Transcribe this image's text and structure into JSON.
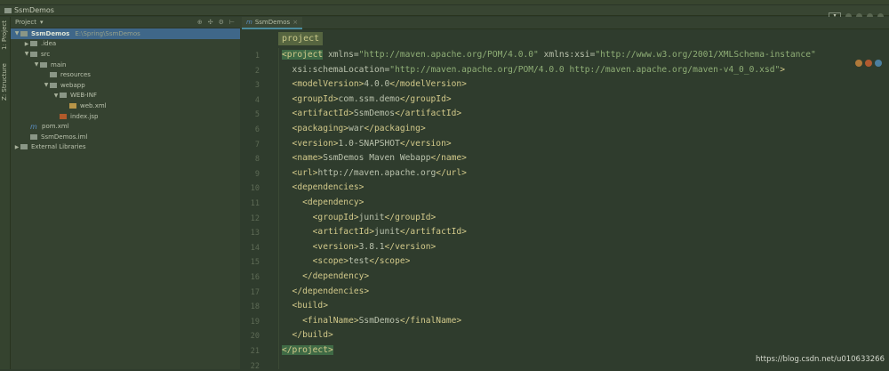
{
  "nav": {
    "project_name": "SsmDemos"
  },
  "side_strip": {
    "project_tab": "1: Project",
    "structure_tab": "Z: Structure"
  },
  "project_panel": {
    "view_label": "Project",
    "tree": [
      {
        "label": "SsmDemos",
        "path": "E:\\Spring\\SsmDemos",
        "depth": 0,
        "arrow": "▼",
        "icon": "folder",
        "selected": true
      },
      {
        "label": ".idea",
        "depth": 1,
        "arrow": "▶",
        "icon": "folder"
      },
      {
        "label": "src",
        "depth": 1,
        "arrow": "▼",
        "icon": "folder"
      },
      {
        "label": "main",
        "depth": 2,
        "arrow": "▼",
        "icon": "folder"
      },
      {
        "label": "resources",
        "depth": 3,
        "arrow": "",
        "icon": "folder"
      },
      {
        "label": "webapp",
        "depth": 3,
        "arrow": "▼",
        "icon": "folder"
      },
      {
        "label": "WEB-INF",
        "depth": 4,
        "arrow": "▼",
        "icon": "folder"
      },
      {
        "label": "web.xml",
        "depth": 5,
        "arrow": "",
        "icon": "xml"
      },
      {
        "label": "index.jsp",
        "depth": 4,
        "arrow": "",
        "icon": "jsp"
      },
      {
        "label": "pom.xml",
        "depth": 1,
        "arrow": "",
        "icon": "maven"
      },
      {
        "label": "SsmDemos.iml",
        "depth": 1,
        "arrow": "",
        "icon": "file"
      },
      {
        "label": "External Libraries",
        "depth": 0,
        "arrow": "▶",
        "icon": "library"
      }
    ]
  },
  "editor": {
    "tab_label": "SsmDemos",
    "breadcrumb": "project",
    "lines": [
      [
        [
          "hl",
          "<project"
        ],
        [
          "a",
          " xmlns="
        ],
        [
          "s",
          "\"http://maven.apache.org/POM/4.0.0\""
        ],
        [
          "a",
          " xmlns:xsi="
        ],
        [
          "s",
          "\"http://www.w3.org/2001/XMLSchema-instance\""
        ]
      ],
      [
        [
          "a",
          "  xsi:schemaLocation="
        ],
        [
          "s",
          "\"http://maven.apache.org/POM/4.0.0 http://maven.apache.org/maven-v4_0_0.xsd\""
        ],
        [
          "t",
          ">"
        ]
      ],
      [
        [
          "t",
          "  <modelVersion>"
        ],
        [
          "v",
          "4.0.0"
        ],
        [
          "t",
          "</modelVersion>"
        ]
      ],
      [
        [
          "t",
          "  <groupId>"
        ],
        [
          "v",
          "com.ssm.demo"
        ],
        [
          "t",
          "</groupId>"
        ]
      ],
      [
        [
          "t",
          "  <artifactId>"
        ],
        [
          "v",
          "SsmDemos"
        ],
        [
          "t",
          "</artifactId>"
        ]
      ],
      [
        [
          "t",
          "  <packaging>"
        ],
        [
          "v",
          "war"
        ],
        [
          "t",
          "</packaging>"
        ]
      ],
      [
        [
          "t",
          "  <version>"
        ],
        [
          "v",
          "1.0-SNAPSHOT"
        ],
        [
          "t",
          "</version>"
        ]
      ],
      [
        [
          "t",
          "  <name>"
        ],
        [
          "v",
          "SsmDemos Maven Webapp"
        ],
        [
          "t",
          "</name>"
        ]
      ],
      [
        [
          "t",
          "  <url>"
        ],
        [
          "v",
          "http://maven.apache.org"
        ],
        [
          "t",
          "</url>"
        ]
      ],
      [
        [
          "t",
          "  <dependencies>"
        ]
      ],
      [
        [
          "t",
          "    <dependency>"
        ]
      ],
      [
        [
          "t",
          "      <groupId>"
        ],
        [
          "v",
          "junit"
        ],
        [
          "t",
          "</groupId>"
        ]
      ],
      [
        [
          "t",
          "      <artifactId>"
        ],
        [
          "v",
          "junit"
        ],
        [
          "t",
          "</artifactId>"
        ]
      ],
      [
        [
          "t",
          "      <version>"
        ],
        [
          "v",
          "3.8.1"
        ],
        [
          "t",
          "</version>"
        ]
      ],
      [
        [
          "t",
          "      <scope>"
        ],
        [
          "v",
          "test"
        ],
        [
          "t",
          "</scope>"
        ]
      ],
      [
        [
          "t",
          "    </dependency>"
        ]
      ],
      [
        [
          "t",
          "  </dependencies>"
        ]
      ],
      [
        [
          "t",
          "  <build>"
        ]
      ],
      [
        [
          "t",
          "    <finalName>"
        ],
        [
          "v",
          "SsmDemos"
        ],
        [
          "t",
          "</finalName>"
        ]
      ],
      [
        [
          "t",
          "  </build>"
        ]
      ],
      [
        [
          "hl",
          "</project>"
        ]
      ],
      []
    ]
  },
  "watermark": "https://blog.csdn.net/u010633266"
}
